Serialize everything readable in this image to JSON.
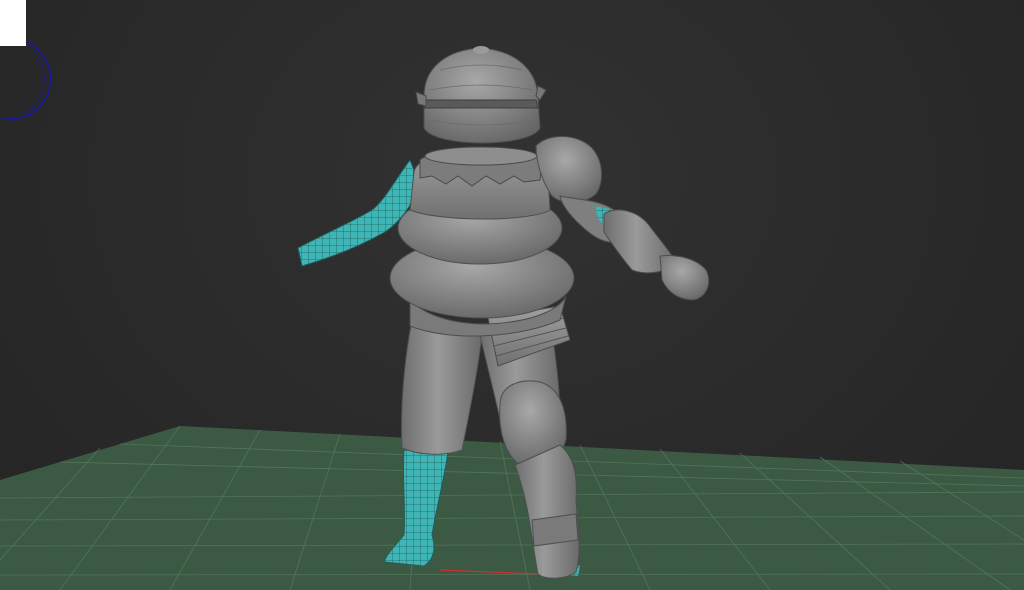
{
  "viewport": {
    "colors": {
      "background": "#2b2b2b",
      "grid_plane": "#3c5a43",
      "grid_line": "#5b7a62",
      "armor": "#8a8a8a",
      "armor_dark": "#5e5e5e",
      "armor_light": "#a6a6a6",
      "wireframe_skin": "#3fb5b5",
      "view_cube_ring": "#1c1c86",
      "axis_x": "#c83232"
    },
    "icons": {
      "view_cube": "view-cube-ring-icon",
      "panel": "white-panel-icon"
    }
  }
}
